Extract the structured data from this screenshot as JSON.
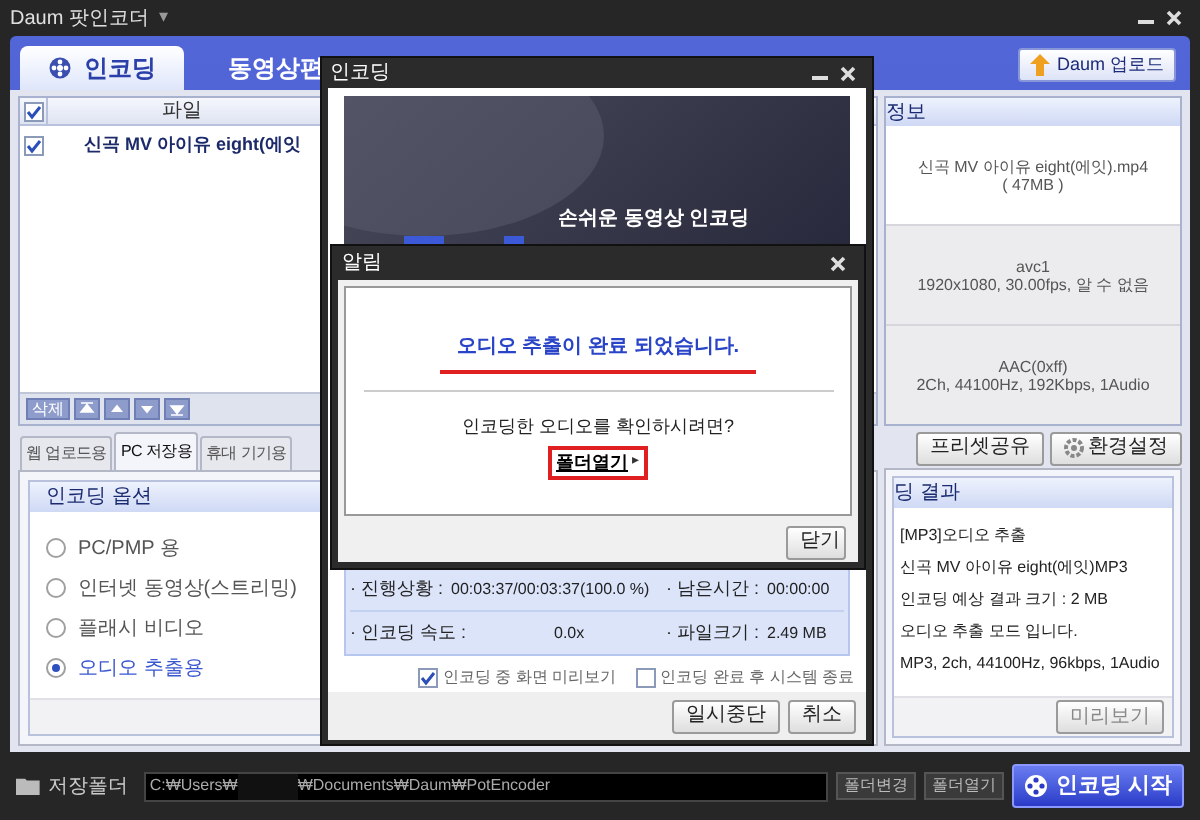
{
  "window": {
    "title": "Daum 팟인코더",
    "menu_glyph": "▾"
  },
  "main_tabs": [
    {
      "label": "인코딩",
      "selected": true
    },
    {
      "label": "동영상편",
      "selected": false
    }
  ],
  "upload_button": "Daum 업로드",
  "file_list": {
    "column": "파일",
    "header_checked": true,
    "rows": [
      {
        "name": "신곡 MV 아이유 eight(에잇",
        "checked": true
      }
    ]
  },
  "list_toolbar": [
    {
      "kind": "text",
      "label": "삭제"
    },
    {
      "kind": "top"
    },
    {
      "kind": "up"
    },
    {
      "kind": "down"
    },
    {
      "kind": "bottom"
    }
  ],
  "preset_tabs": [
    {
      "label": "웹 업로드용",
      "selected": false
    },
    {
      "label": "PC 저장용",
      "selected": true
    },
    {
      "label": "휴대 기기용",
      "selected": false
    }
  ],
  "options": {
    "title": "인코딩 옵션",
    "items": [
      {
        "label": "PC/PMP 용",
        "selected": false
      },
      {
        "label": "인터넷 동영상(스트리밍)",
        "selected": false
      },
      {
        "label": "플래시 비디오",
        "selected": false
      },
      {
        "label": "오디오 추출용",
        "selected": true
      }
    ]
  },
  "info": {
    "title": "정보",
    "blocks": [
      {
        "lines": [
          "신곡 MV 아이유 eight(에잇).mp4",
          "( 47MB )"
        ]
      },
      {
        "lines": [
          "avc1",
          "1920x1080, 30.00fps, 알 수 없음"
        ]
      },
      {
        "lines": [
          "AAC(0xff)",
          "2Ch, 44100Hz, 192Kbps, 1Audio"
        ]
      }
    ]
  },
  "info_buttons": [
    {
      "kind": "plain",
      "label": "프리셋공유"
    },
    {
      "kind": "gear",
      "label": "환경설정"
    }
  ],
  "result": {
    "title": "딩 결과",
    "lines": [
      "[MP3]오디오 추출",
      "신곡 MV 아이유 eight(에잇)MP3",
      "인코딩 예상 결과 크기 : 2 MB",
      "오디오 추출 모드 입니다.",
      "MP3, 2ch, 44100Hz, 96kbps, 1Audio"
    ],
    "button": "미리보기"
  },
  "footer": {
    "label": "저장폴더",
    "path_start": "C:₩Users₩",
    "path_end": "₩Documents₩Daum₩PotEncoder",
    "buttons": [
      "폴더변경",
      "폴더열기"
    ],
    "start_button": "인코딩 시작"
  },
  "encode_dialog": {
    "title": "인코딩",
    "banner_text": "손쉬운 동영상 인코딩",
    "stats": [
      {
        "label": "· 진행상황 :",
        "value": "00:03:37/00:03:37(100.0 %)"
      },
      {
        "label": "· 남은시간 :",
        "value": "00:00:00"
      },
      {
        "label": "· 인코딩 속도 :",
        "value": "0.0x"
      },
      {
        "label": "· 파일크기 :",
        "value": "2.49 MB"
      }
    ],
    "checks": [
      {
        "label": "인코딩 중 화면 미리보기",
        "checked": true
      },
      {
        "label": "인코딩 완료 후 시스템 종료",
        "checked": false
      }
    ],
    "buttons": [
      "일시중단",
      "취소"
    ]
  },
  "alert": {
    "title": "알림",
    "message": "오디오 추출이 완료 되었습니다.",
    "prompt": "인코딩한 오디오를 확인하시려면?",
    "link": "폴더열기",
    "link_glyph": "▸",
    "button": "닫기"
  }
}
